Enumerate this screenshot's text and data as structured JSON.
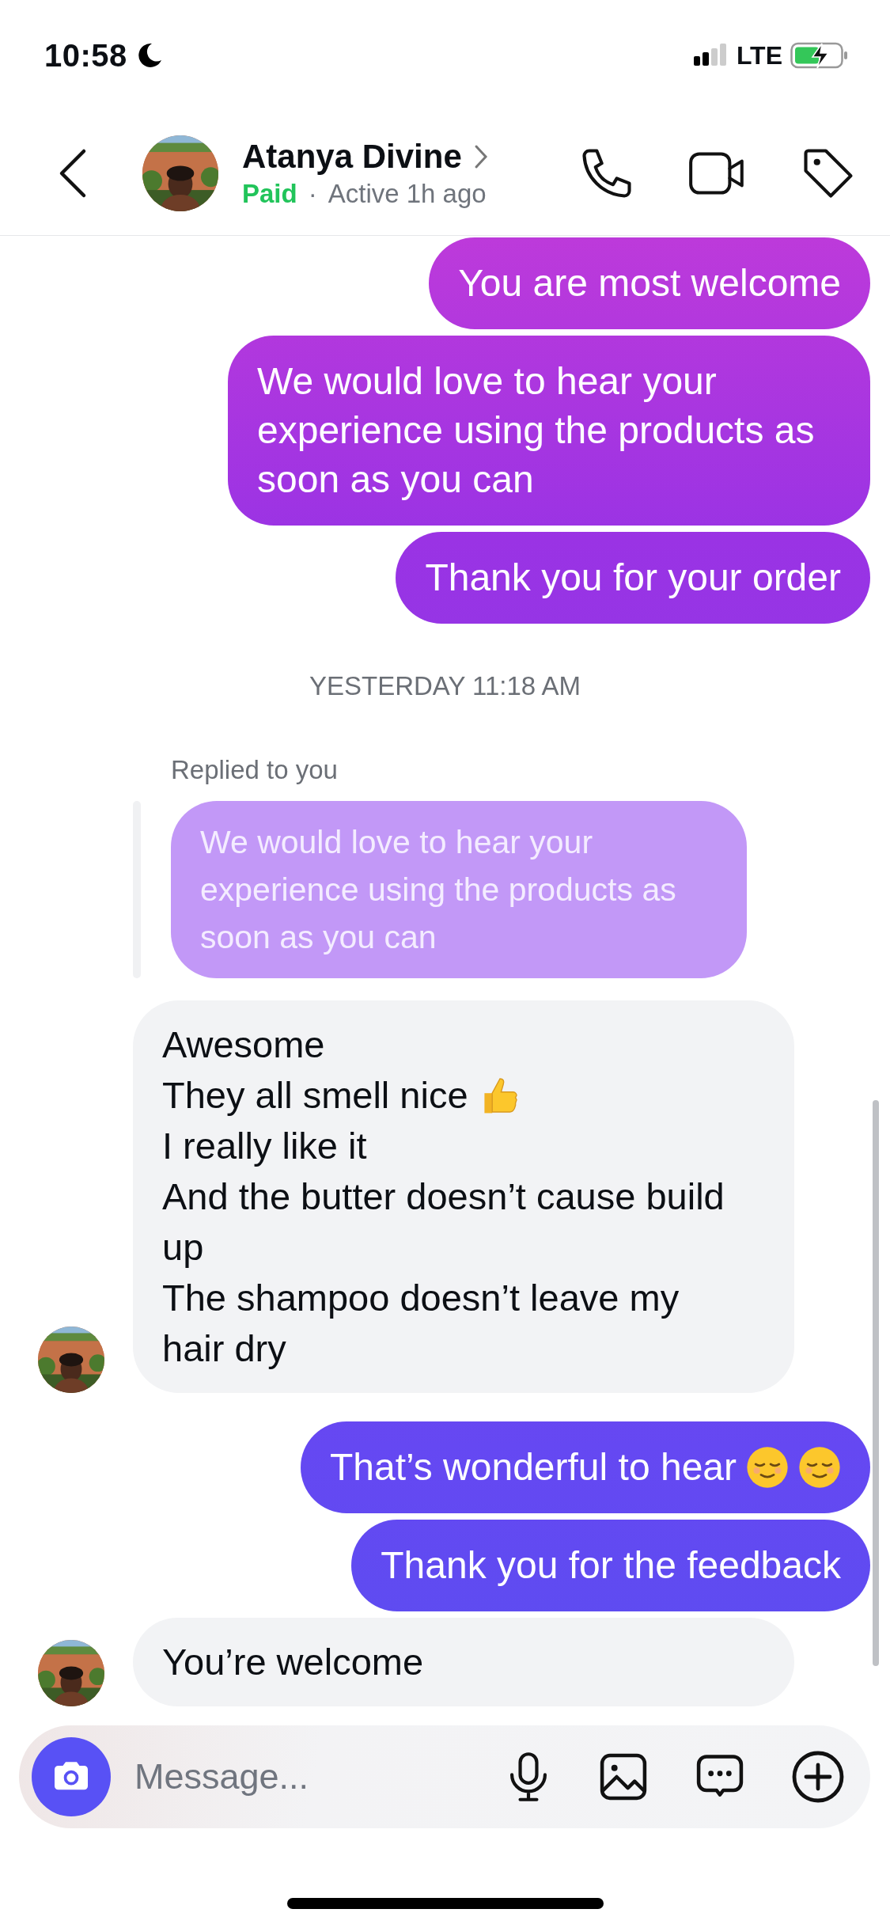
{
  "status_bar": {
    "time": "10:58",
    "network": "LTE"
  },
  "header": {
    "name": "Atanya Divine",
    "badge": "Paid",
    "separator": "·",
    "activity": "Active 1h ago"
  },
  "messages": [
    {
      "kind": "outgoing",
      "lines": [
        {
          "text": "You are most welcome"
        }
      ]
    },
    {
      "kind": "outgoing",
      "lines": [
        {
          "text": "We would love to hear your experience using the products as soon as you can"
        }
      ]
    },
    {
      "kind": "outgoing",
      "lines": [
        {
          "text": "Thank you for your order"
        }
      ]
    },
    {
      "kind": "timestamp",
      "text": "YESTERDAY 11:18 AM"
    },
    {
      "kind": "reply_label",
      "text": "Replied to you"
    },
    {
      "kind": "quote",
      "lines": [
        {
          "text": "We would love to hear your experience using the products as soon as you can"
        }
      ]
    },
    {
      "kind": "incoming",
      "lines": [
        {
          "text": "Awesome"
        },
        {
          "text": "They all smell nice",
          "icons": [
            {
              "kind": "thumbs-up"
            }
          ]
        },
        {
          "text": "I really like it"
        },
        {
          "text": "And the butter doesn’t cause build up"
        },
        {
          "text": "The shampoo doesn’t leave my hair dry"
        }
      ]
    },
    {
      "kind": "outgoing",
      "lines": [
        {
          "text": "That’s wonderful to hear",
          "icons": [
            {
              "kind": "relieved-face"
            },
            {
              "kind": "relieved-face"
            }
          ]
        }
      ]
    },
    {
      "kind": "outgoing",
      "lines": [
        {
          "text": "Thank you for the feedback"
        }
      ]
    },
    {
      "kind": "incoming",
      "lines": [
        {
          "text": "You’re welcome"
        }
      ]
    }
  ],
  "composer": {
    "placeholder": "Message..."
  }
}
